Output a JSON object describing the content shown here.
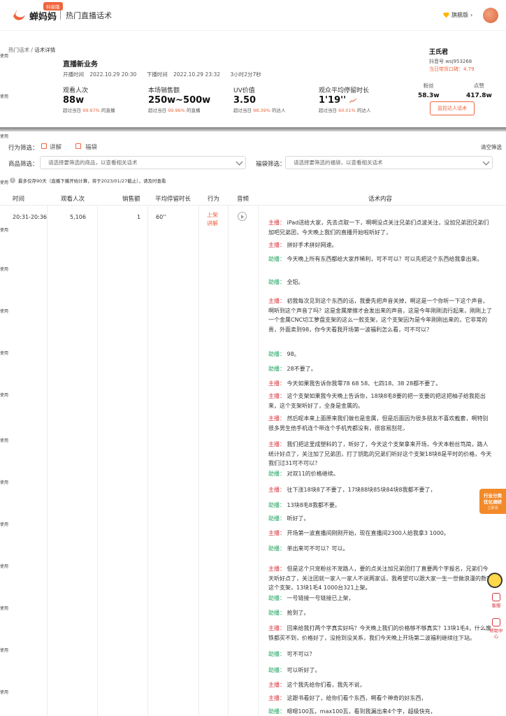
{
  "topbar": {
    "logo_text": "蝉妈妈",
    "logo_badge": "抖音版",
    "page_name": "热门直播话术",
    "version_label": "旗舰版",
    "brand_color": "#f0643c"
  },
  "breadcrumb": {
    "parent": "热门话术",
    "separator": " / ",
    "current": "话术详情"
  },
  "stream": {
    "title": "直播新业务",
    "start_label": "开播时间",
    "start_time": "2022.10.29 20:30",
    "end_label": "下播时间",
    "end_time": "2022.10.29 23:32",
    "duration": "3小时2分7秒"
  },
  "metrics": [
    {
      "label": "观看人次",
      "value": "88w",
      "sub_prefix": "超过当日",
      "pct": "99.97%",
      "sub_suffix": "的直播"
    },
    {
      "label": "本场销售额",
      "value": "250w~500w",
      "sub_prefix": "超过当日",
      "pct": "99.96%",
      "sub_suffix": "的直播"
    },
    {
      "label": "UV价值",
      "value": "3.50",
      "sub_prefix": "超过当日",
      "pct": "98.39%",
      "sub_suffix": "的达人"
    },
    {
      "label": "观众平均停留时长",
      "value": "1'19''",
      "sub_prefix": "超过当日",
      "pct": "60.01%",
      "sub_suffix": "的达人"
    }
  ],
  "user": {
    "name": "王氏君",
    "douyin_id": "抖音号 wsj953268",
    "rank": "当日带货口碑：4.79",
    "fans_label": "粉丝",
    "fans_value": "58.3w",
    "likes_label": "点赞",
    "likes_value": "417.8w",
    "monitor_button": "监控达人话术"
  },
  "watermark": "使用",
  "filters": {
    "behavior_label": "行为筛选：",
    "options": [
      "讲解",
      "福袋"
    ],
    "clear": "清空筛选",
    "product_label": "商品筛选：",
    "product_placeholder": "请选择要筛选的商品，以查看相关话术",
    "bag_label": "福袋筛选：",
    "bag_placeholder": "请选择要筛选的福袋，以查看相关话术",
    "note": "最多仅存90天（直播下播开始计算，将于2023/01/27截止），请及时查看"
  },
  "table": {
    "headers": [
      "时间",
      "观看人次",
      "销售额",
      "平均停留时长",
      "行为",
      "音频",
      "话术内容"
    ],
    "row": {
      "time": "20:31-20:36",
      "viewers": "5,106",
      "sales": "1",
      "avg_stay": "60''",
      "behavior": [
        "上架",
        "讲解"
      ]
    }
  },
  "script_lines": [
    {
      "speaker": "主播",
      "text": "iPad送给大家，先去点取一下，啊啊没点关注兄弟们点波关注，没加兄弟团兄弟们加吧兄弟团，今天晚上我们的直播开始啦听好了，"
    },
    {
      "speaker": "主播",
      "text": "拼好手术拼好网速。"
    },
    {
      "speaker": "助播",
      "text": "今天晚上所有东西都给大家炸稀利，可不可以？可以先把这个东西给我拿出来。"
    },
    {
      "speaker": "助播",
      "text": "全铝。"
    },
    {
      "speaker": "主播",
      "text": "初我每次见到这个东西的话，我要先把声音关掉，啊这是一个你听一下这个声音，啊听到这个声音了吗？这是金属摩擦才会发出来的声音，这是今年刚刚流行起来，刚刚上了一个金属CNC切工萝盘支架的这么一款支架，这个支架因为是今年刚刚出来的，它非常的贵，外面卖到98，你今天看我开场第一波福利怎么看，可不可以？"
    },
    {
      "speaker": "助播",
      "text": "98。"
    },
    {
      "speaker": "助播",
      "text": "28不要了。"
    },
    {
      "speaker": "主播",
      "text": "今天如果我告诉你我零78 68 58、七四18、38 28都不要了。"
    },
    {
      "speaker": "主播",
      "text": "这个支架如果我今天晚上告诉你，18块8毛8要的把一支要的把这把柚子给我拒出来，这个支架听好了，全身是金属的。"
    },
    {
      "speaker": "主播",
      "text": "然后呢本来上面原来我们做也是金属，但是后面因为很多朋友不喜欢截套，啊特别很多男生他手机连个带连个手机壳都没有，很容易刮花，"
    },
    {
      "speaker": "主播",
      "text": "我们把这里成塑料的了，听好了，今天这个支架拿来开场，今天本粉丝笃简，路人统计好点了，关注加了兄弟团，打了钥匙的兄弟们听好这个支架18块8是平时的价格，今天我们过31可不可以？"
    },
    {
      "speaker": "助播",
      "text": "对双11的价格继续。"
    },
    {
      "speaker": "主播",
      "text": "往下涨18块8了不要了，17块88块85块84块8我都不要了，"
    },
    {
      "speaker": "助播",
      "text": "13块8毛8我都不要。"
    },
    {
      "speaker": "助播",
      "text": "听好了。"
    },
    {
      "speaker": "主播",
      "text": "开场第一波直播间刚刚开始，现在直播间2300人给我拿3 1000。"
    },
    {
      "speaker": "助播",
      "text": "单出来可不可以？可以。"
    },
    {
      "speaker": "主播",
      "text": "但是这个只宠粉丝不宠路人，要的点关注加兄弟团打了直要两个字报名，兄弟们今天听好点了，关注团就一家人一家人不说两家话，我希望可以跟大家一生一世做浪漫的数字这个支架，13块1毛4 1000台321上架。"
    },
    {
      "speaker": "助播",
      "text": "一号链接一号链接已上架，"
    },
    {
      "speaker": "助播",
      "text": "抢到了。"
    },
    {
      "speaker": "主播",
      "text": "回来给我打两个字真实好吗？今天晚上我们的价格够不够真实？13块1毛4，什么废铁都买不到，价格好了，没抢到没关系，我们今天晚上开场第二波福利继续往下站。"
    },
    {
      "speaker": "助播",
      "text": "可不可以？"
    },
    {
      "speaker": "助播",
      "text": "可以听好了。"
    },
    {
      "speaker": "主播",
      "text": "这个我先给你们看，我先不说，"
    },
    {
      "speaker": "主播",
      "text": "这跟书看好了，给你们看个东西，啊看个神奇的好东西，"
    },
    {
      "speaker": "助播",
      "text": "嗯嗯100瓦，max100瓦，看到我漏出来4个字，超级快充，"
    }
  ],
  "floating": {
    "card_line1": "行业分类",
    "card_line2": "优化调研",
    "card_line3": "立即领",
    "feedback": "客服",
    "help": "帮助中心"
  }
}
